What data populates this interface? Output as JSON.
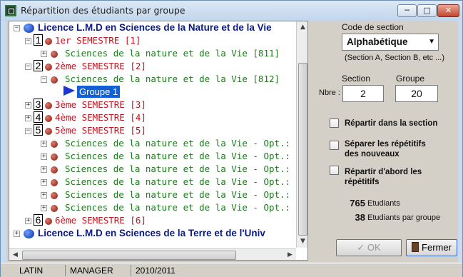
{
  "window": {
    "title": "Répartition des étudiants par groupe",
    "minimize": "─",
    "maximize": "□",
    "close": "✕"
  },
  "tree": {
    "licence1": "Licence L.M.D en Sciences de la Nature et de la Vie",
    "sem1": {
      "num": "1",
      "label": "1er SEMESTRE  [1]"
    },
    "sem1_item": "Sciences de la nature et de la Vie [811]",
    "sem2": {
      "num": "2",
      "label": "2ème SEMESTRE  [2]"
    },
    "sem2_item": "Sciences de la nature et de la Vie [812]",
    "group1": "Groupe 1",
    "sem3": {
      "num": "3",
      "label": "3ème SEMESTRE  [3]"
    },
    "sem4": {
      "num": "4",
      "label": "4ème SEMESTRE  [4]"
    },
    "sem5": {
      "num": "5",
      "label": "5ème SEMESTRE  [5]"
    },
    "sem5_items": [
      "Sciences de la nature et de la Vie - Opt.: Ecolo",
      "Sciences de la nature et de la Vie - Opt.: Bioch",
      "Sciences de la nature et de la Vie - Opt.: Micro",
      "Sciences de la nature et de la Vie - Opt.: Ecolo",
      "Sciences de la nature et de la Vie - Opt.: Bio Ec",
      "Sciences de la nature et de la Vie - Opt.: Physi"
    ],
    "sem6": {
      "num": "6",
      "label": "6ème SEMESTRE  [6]"
    },
    "licence2": "Licence L.M.D en Sciences de la Terre et de l'Univ"
  },
  "panel": {
    "code_section_label": "Code de section",
    "code_section_value": "Alphabétique",
    "code_section_hint": "(Section A, Section B, etc ...)",
    "section_label": "Section",
    "groupe_label": "Groupe",
    "nbre_label": "Nbre :",
    "section_value": "2",
    "groupe_value": "20",
    "opt1": "Répartir dans la section",
    "opt2_l1": "Séparer les répétitifs",
    "opt2_l2": "des nouveaux",
    "opt3_l1": "Répartir d'abord  les",
    "opt3_l2": "répétitifs",
    "etudiants_count": "765",
    "etudiants_label": "Etudiants",
    "per_group_count": "38",
    "per_group_label": "Etudiants par groupe",
    "ok_label": "OK",
    "fermer_label": "Fermer"
  },
  "status": {
    "p1": "LATIN",
    "p2": "MANAGER",
    "p3": "2010/2011"
  }
}
